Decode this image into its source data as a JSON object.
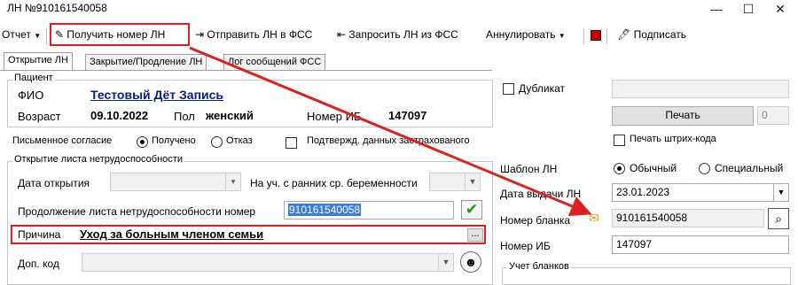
{
  "window": {
    "title": "ЛН №910161540058",
    "minimize": "—",
    "maximize": "☐",
    "close": "✕"
  },
  "toolbar": {
    "report": "Отчет",
    "get_number": "Получить номер ЛН",
    "send_fss": "Отправить ЛН в ФСС",
    "request_fss": "Запросить ЛН из ФСС",
    "annul": "Аннулировать",
    "sign": "Подписать"
  },
  "tabs": [
    {
      "label": "Открытие ЛН"
    },
    {
      "label": "Закрытие/Продление ЛН"
    },
    {
      "label": "Лог сообщений ФСС"
    }
  ],
  "patient": {
    "group_title": "Пациент",
    "fio_label": "ФИО",
    "fio_value": "Тестовый Дёт Запись",
    "age_label": "Возраст",
    "age_value": "09.10.2022",
    "sex_label": "Пол",
    "sex_value": "женский",
    "ib_label": "Номер ИБ",
    "ib_value": "147097"
  },
  "consent": {
    "label": "Письменное согласие",
    "received": "Получено",
    "refused": "Отказ",
    "confirm_label": "Подтвержд. данных застрахованого"
  },
  "opening": {
    "group_title": "Открытие листа нетрудоспособности",
    "date_label": "Дата открытия",
    "early_preg_label": "На уч. с ранних ср. беременности",
    "continuation_label": "Продолжение листа нетрудоспособности номер",
    "continuation_value": "910161540058",
    "reason_label": "Причина",
    "reason_value": "Уход за больным членом семьи",
    "reason_btn": "...",
    "extra_code_label": "Доп. код"
  },
  "right": {
    "duplicate_label": "Дубликат",
    "print_btn": "Печать",
    "print_count": "0",
    "print_barcode_label": "Печать штрих-кода",
    "template_label": "Шаблон ЛН",
    "template_normal": "Обычный",
    "template_special": "Специальный",
    "issue_date_label": "Дата выдачи ЛН",
    "issue_date_value": "23.01.2023",
    "blank_number_label": "Номер бланка",
    "blank_number_value": "910161540058",
    "ib_label": "Номер ИБ",
    "ib_value": "147097",
    "blanks_group_title": "Учет бланков"
  },
  "colors": {
    "highlight": "#e02020",
    "link": "#0a1e8a",
    "selection": "#3b7ddd"
  }
}
